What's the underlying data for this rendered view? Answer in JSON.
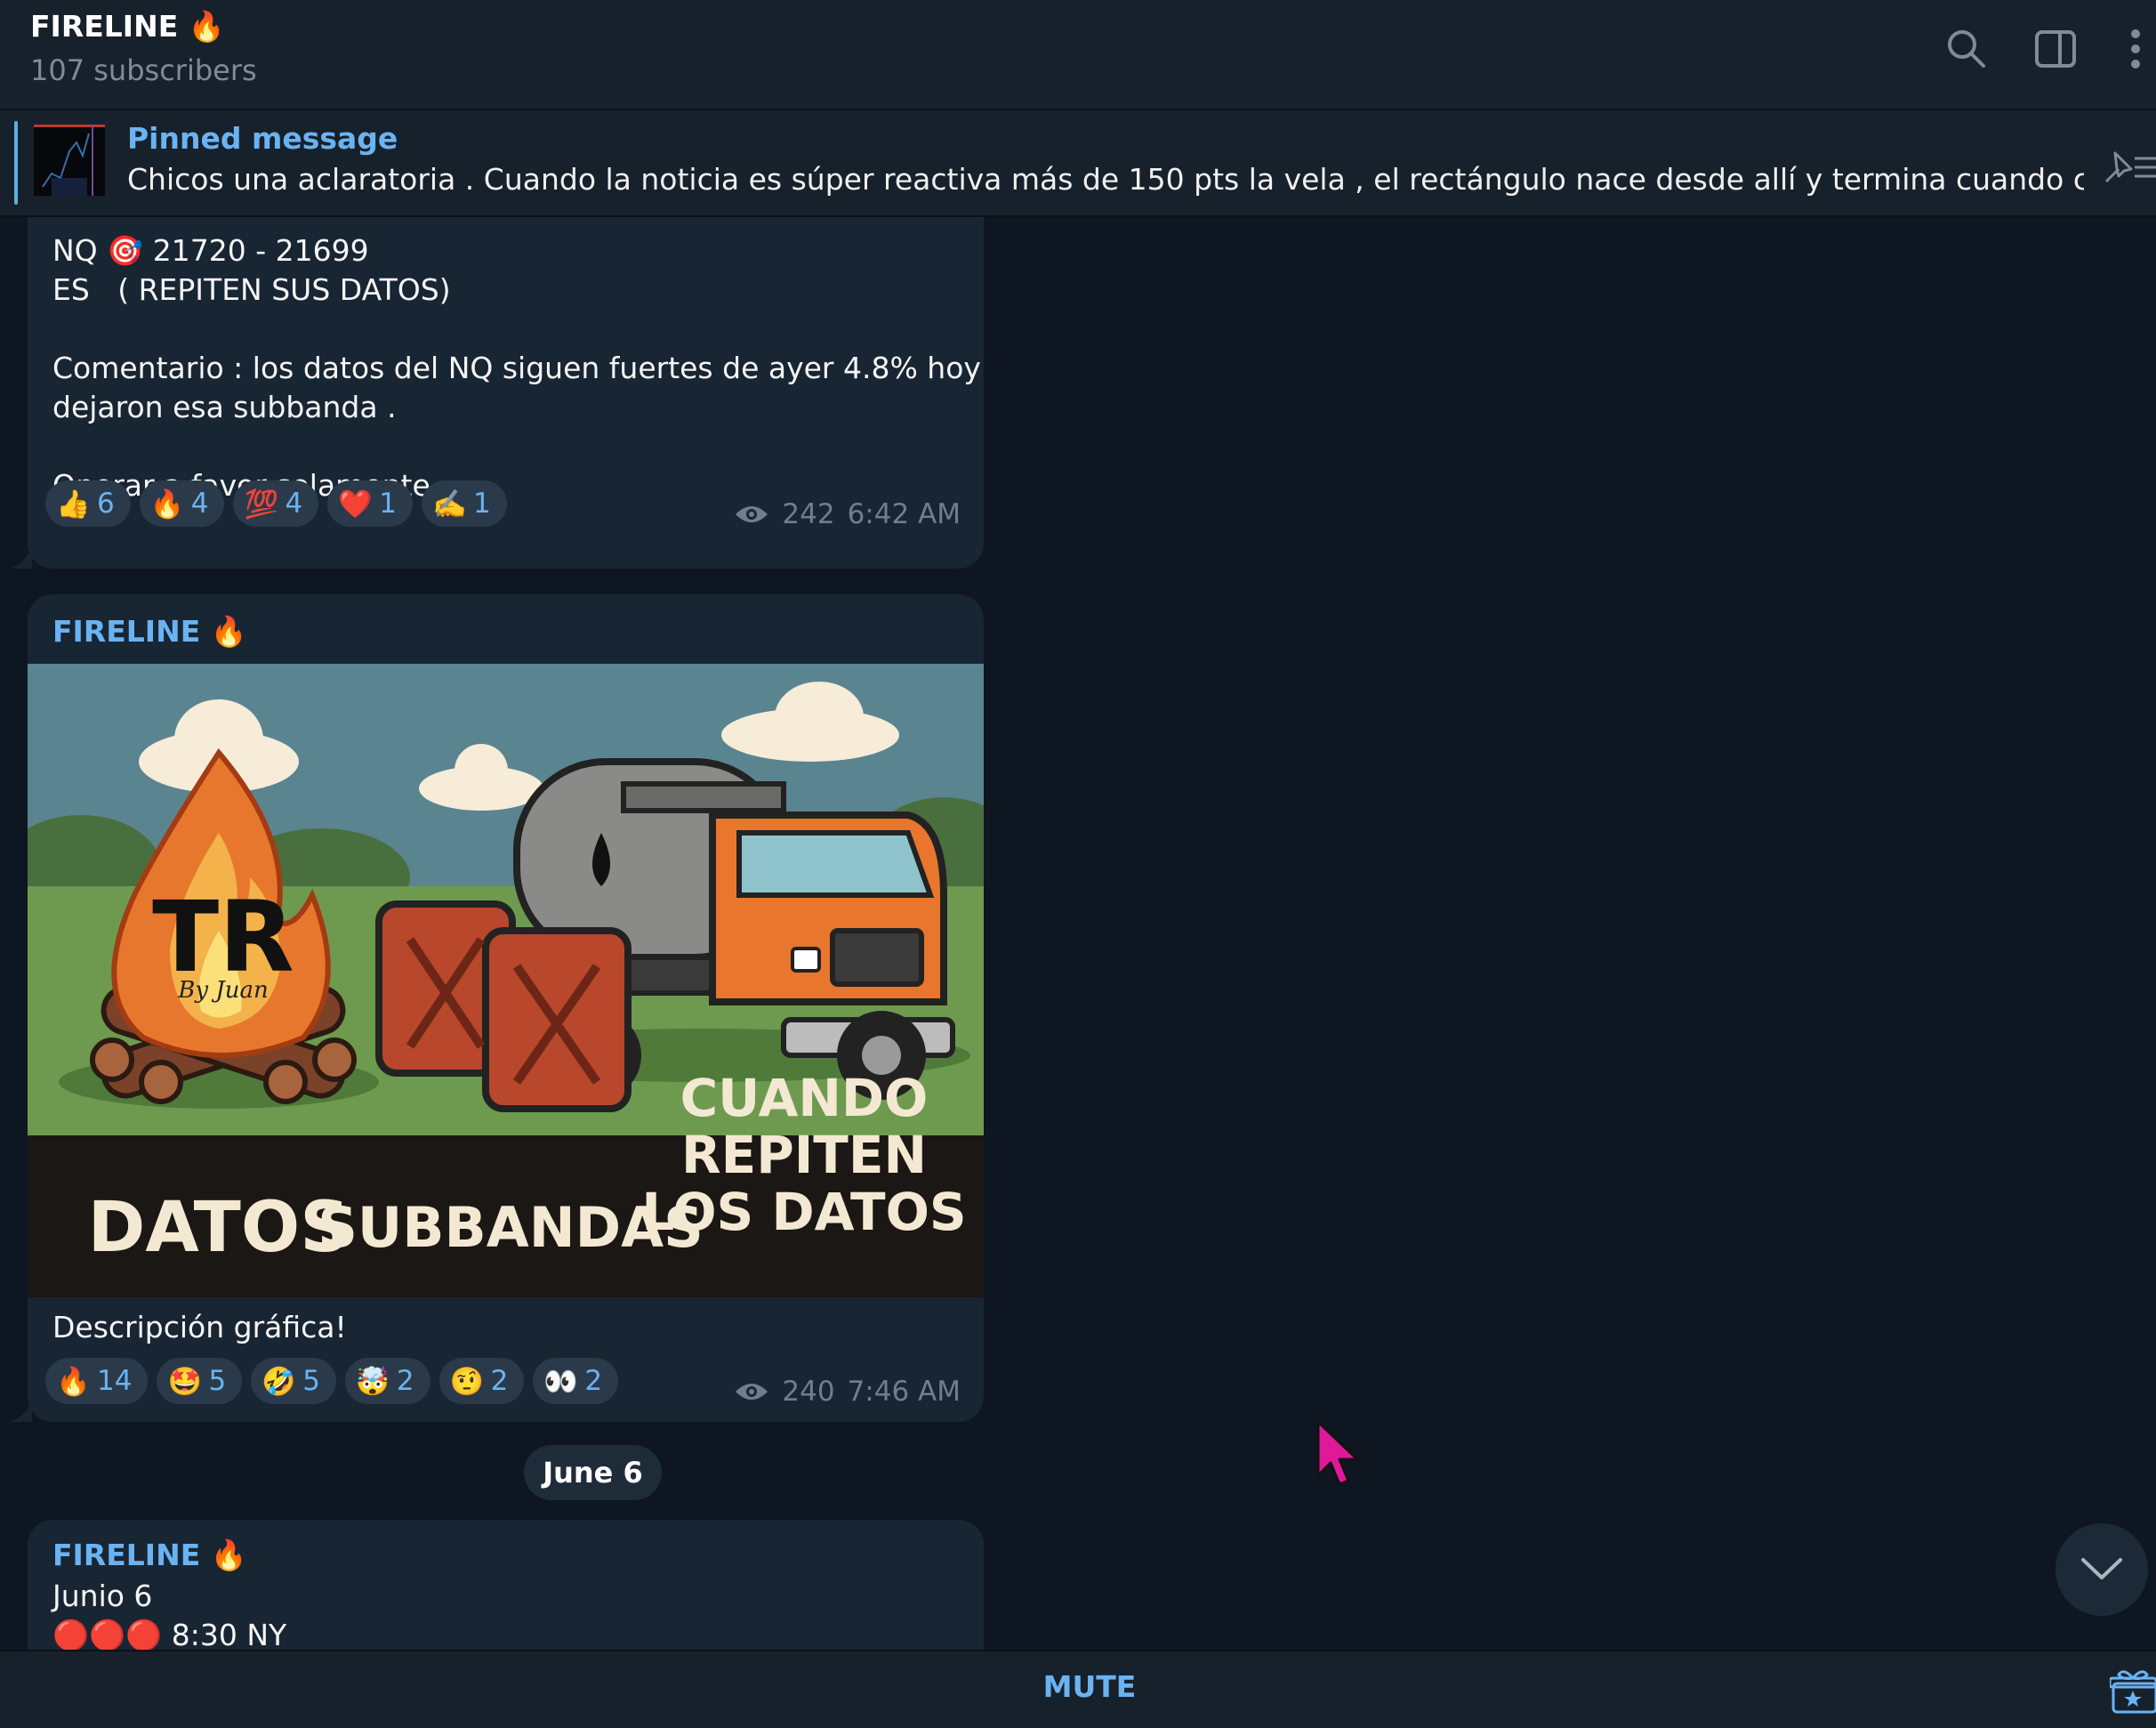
{
  "header": {
    "channel_name": "FIRELINE 🔥",
    "subscribers": "107 subscribers",
    "icons": [
      "search-icon",
      "sidebar-toggle-icon",
      "more-vertical-icon"
    ]
  },
  "pinned": {
    "title": "Pinned message",
    "text": "Chicos una aclaratoria .  Cuando la noticia es súper reactiva más de 150 pts la vela , el rectángulo nace desde allí y termina cuando complete las..."
  },
  "messages": [
    {
      "lines": {
        "l1": "NQ 🎯 21720 - 21699",
        "l2": "ES   ( REPITEN SUS DATOS)",
        "l3": "Comentario : los datos del NQ siguen fuertes de ayer 4.8% hoy",
        "l4": "dejaron esa subbanda .",
        "l5": "Operar a favor solamente ."
      },
      "reactions": [
        {
          "emoji": "👍",
          "count": "6"
        },
        {
          "emoji": "🔥",
          "count": "4"
        },
        {
          "emoji": "💯",
          "count": "4"
        },
        {
          "emoji": "❤️",
          "count": "1"
        },
        {
          "emoji": "✍️",
          "count": "1"
        }
      ],
      "views": "242",
      "time": "6:42 AM"
    },
    {
      "sender": "FIRELINE 🔥",
      "image": {
        "logo_text": "TR",
        "logo_sub": "By Juan",
        "captions": [
          "DATOS",
          "SUBBANDAS",
          "CUANDO",
          "REPITEN",
          "LOS DATOS"
        ]
      },
      "caption": "Descripción gráfica!",
      "reactions": [
        {
          "emoji": "🔥",
          "count": "14"
        },
        {
          "emoji": "🤩",
          "count": "5"
        },
        {
          "emoji": "🤣",
          "count": "5"
        },
        {
          "emoji": "🤯",
          "count": "2"
        },
        {
          "emoji": "🤨",
          "count": "2"
        },
        {
          "emoji": "👀",
          "count": "2"
        }
      ],
      "views": "240",
      "time": "7:46 AM"
    },
    {
      "sender": "FIRELINE 🔥",
      "l1": "Junio 6",
      "l2": "🔴🔴🔴 8:30 NY"
    }
  ],
  "date_separator": "June 6",
  "bottom": {
    "mute_label": "MUTE"
  },
  "colors": {
    "background": "#0e1621",
    "panel": "#17212b",
    "bubble": "#182533",
    "accent": "#6ab3f3"
  }
}
